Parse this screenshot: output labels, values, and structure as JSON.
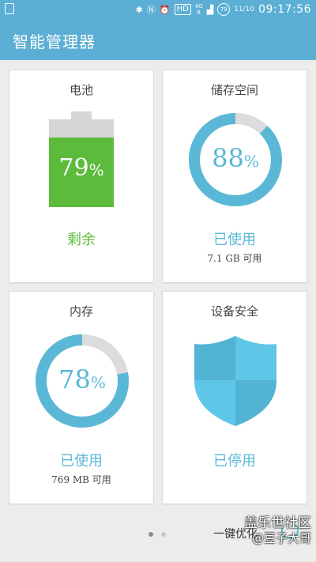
{
  "status_bar": {
    "hd": "HD",
    "network": "4G",
    "battery_level": "79",
    "date": "11/10",
    "time": "09:17:56"
  },
  "app_bar": {
    "title": "智能管理器"
  },
  "cards": {
    "battery": {
      "title": "电池",
      "value": "79",
      "unit": "%",
      "percent": 79,
      "status": "剩余",
      "color": "#5dbb3c"
    },
    "storage": {
      "title": "储存空间",
      "value": "88",
      "unit": "%",
      "percent": 88,
      "status": "已使用",
      "detail": "7.1 GB 可用",
      "color": "#5ab8d6"
    },
    "memory": {
      "title": "内存",
      "value": "78",
      "unit": "%",
      "percent": 78,
      "status": "已使用",
      "detail": "769 MB 可用",
      "color": "#5ab8d6"
    },
    "security": {
      "title": "设备安全",
      "status": "已停用",
      "color": "#5ab8d6"
    }
  },
  "footer": {
    "optimize_label": "一键优化"
  },
  "watermark": {
    "line1": "盖乐世社区",
    "line2": "@豆子大哥"
  },
  "colors": {
    "accent": "#5baed4",
    "ring_track": "#dcdcdc",
    "ring_fill": "#5ab8d6",
    "battery_green": "#5dbb3c"
  }
}
